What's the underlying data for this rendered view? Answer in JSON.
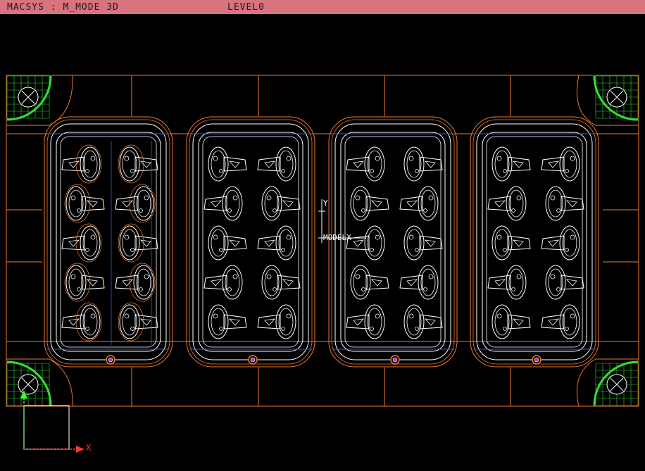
{
  "title_bar": {
    "mode_text": "MACSYS : M_MODE 3D",
    "level_text": "LEVEL0"
  },
  "viewport": {
    "model_axis": {
      "x_label": "X",
      "y_label": "Y",
      "name_label": "MODELX"
    },
    "world_axis": {
      "x_label": "X"
    }
  },
  "colors": {
    "title_bar_bg": "#d9737e",
    "background": "#000000",
    "outline": "#f07a2a",
    "geometry": "#ffffff",
    "guide": "#3a5ccc",
    "corner_mesh": "#33dd33",
    "axis": "#33ff33"
  },
  "icons": [
    "corner-mesh-icon",
    "sprue-gate-icon",
    "axis-triad-icon"
  ]
}
